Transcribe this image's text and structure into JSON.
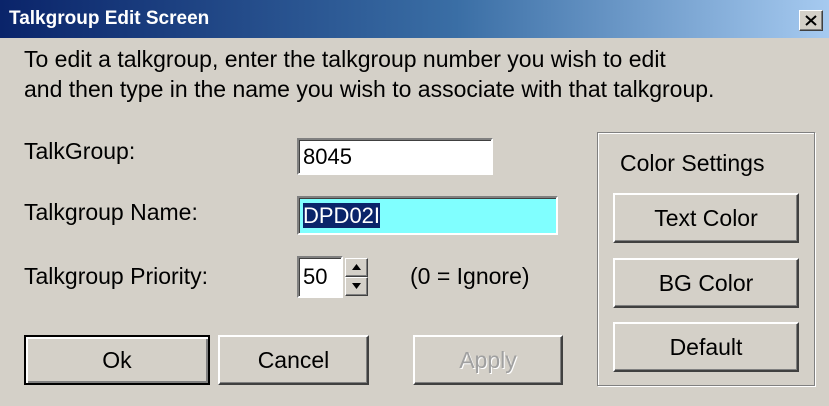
{
  "window": {
    "title": "Talkgroup Edit Screen",
    "close_label": "close"
  },
  "instructions": {
    "line1": "To edit a talkgroup, enter the talkgroup number  you wish to edit",
    "line2": "and then type in the name you wish to associate with that talkgroup."
  },
  "form": {
    "talkgroup_label": "TalkGroup:",
    "talkgroup_value": "8045",
    "name_label": "Talkgroup Name:",
    "name_value": "DPD02I",
    "priority_label": "Talkgroup Priority:",
    "priority_value": "50",
    "priority_hint": "(0 = Ignore)"
  },
  "color_settings": {
    "title": "Color Settings",
    "text_color_label": "Text Color",
    "bg_color_label": "BG Color",
    "default_label": "Default"
  },
  "buttons": {
    "ok_label": "Ok",
    "cancel_label": "Cancel",
    "apply_label": "Apply"
  },
  "icons": {
    "close": "close-icon",
    "spin_up": "arrow-up-icon",
    "spin_down": "arrow-down-icon"
  },
  "colors": {
    "title_bar_start": "#0a246a",
    "title_bar_end": "#a6caf0",
    "active_field_bg": "#80ffff",
    "selection_bg": "#0a246a",
    "dialog_bg": "#d4d0c8"
  }
}
